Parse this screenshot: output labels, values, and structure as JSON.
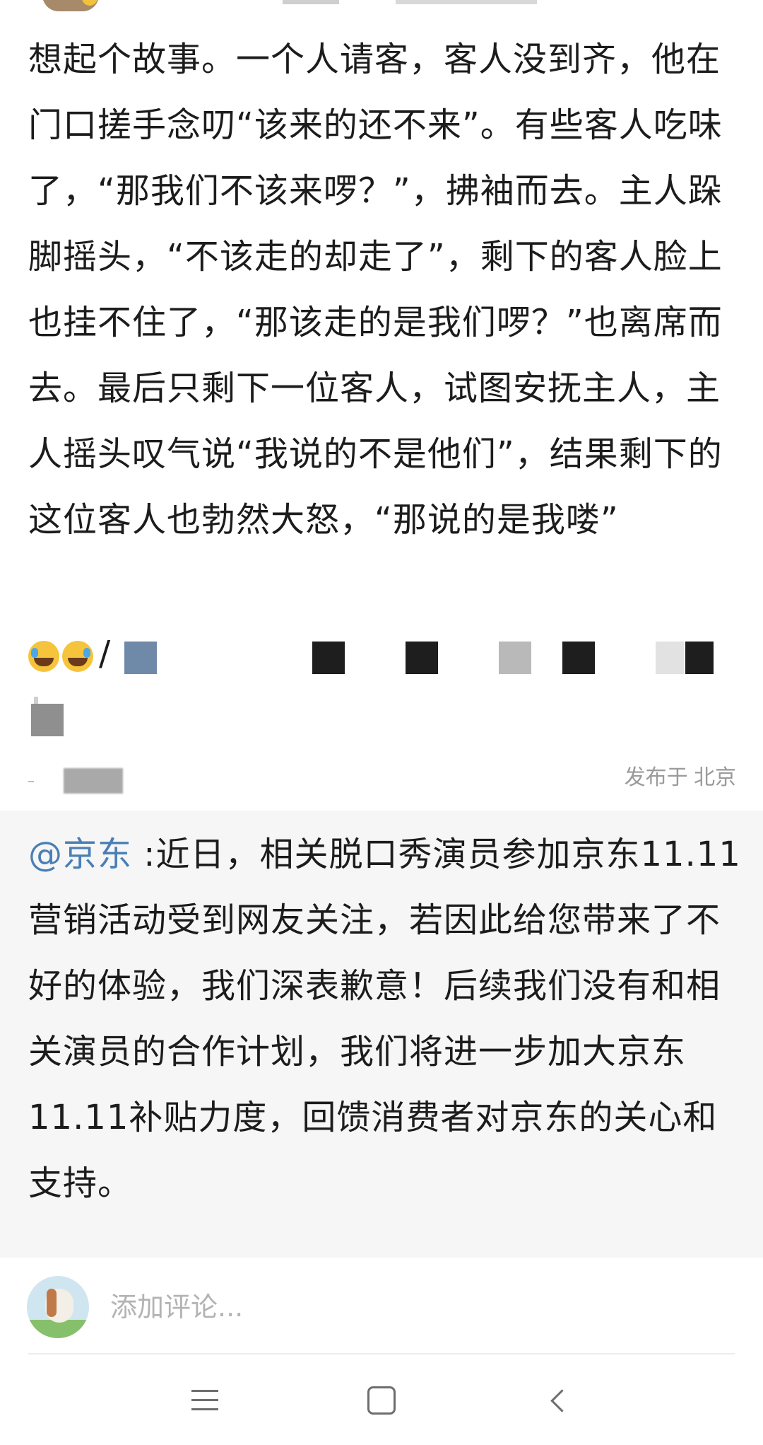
{
  "post": {
    "text": "想起个故事。一个人请客，客人没到齐，他在门口搓手念叨“该来的还不来”。有些客人吃味了，“那我们不该来啰？”，拂袖而去。主人跺脚摇头，“不该走的却走了”，剩下的客人脸上也挂不住了，“那该走的是我们啰？”也离席而去。最后只剩下一位客人，试图安抚主人，主人摇头叹气说“我说的不是他们”，结果剩下的这位客人也勃然大怒，“那说的是我喽”",
    "emoji_icons": [
      "laugh-cry-icon",
      "laugh-cry-icon"
    ],
    "separator": "/",
    "meta": "发布于 北京"
  },
  "quote": {
    "mention": "@京东",
    "text": ":近日，相关脱口秀演员参加京东11.11营销活动受到网友关注，若因此给您带来了不好的体验，我们深表歉意！后续我们没有和相关演员的合作计划，我们将进一步加大京东11.11补贴力度，回馈消费者对京东的关心和支持。",
    "colors": {
      "mention": "#4a7fb5",
      "background": "#f6f6f6"
    }
  },
  "comment": {
    "placeholder": "添加评论..."
  },
  "navbar": {
    "icons": [
      "menu-icon",
      "home-icon",
      "back-icon"
    ]
  },
  "colors": {
    "text": "#1c1c1c",
    "meta": "#9a9a9a",
    "placeholder": "#b3b3b3"
  }
}
